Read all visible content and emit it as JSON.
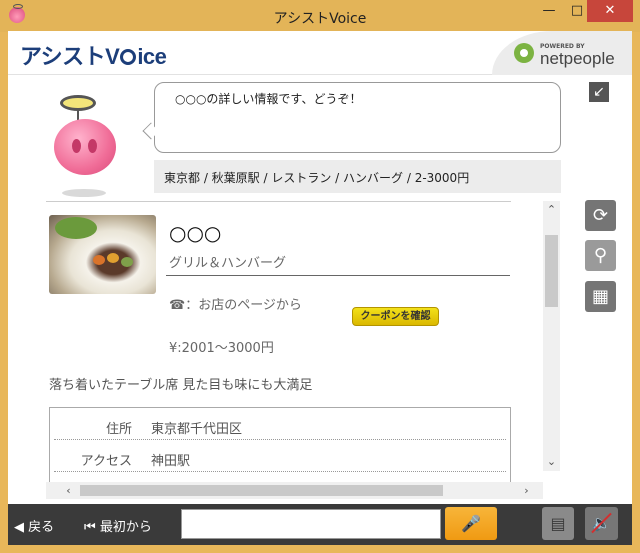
{
  "window": {
    "title": "アシストVoice",
    "min_glyph": "—",
    "max_glyph": "□",
    "close_glyph": "✕"
  },
  "header": {
    "brand_prefix": "アシスト",
    "brand_v": "V",
    "brand_suffix": "ice",
    "powered_by": "POWERED BY",
    "partner": "netpeople"
  },
  "assistant": {
    "message": "○○○の詳しい情報です、どうぞ！",
    "breadcrumb": "東京都 / 秋葉原駅 / レストラン / ハンバーグ / 2-3000円",
    "collapse_glyph": "↙"
  },
  "restaurant": {
    "name": "○○○",
    "genre": "グリル＆ハンバーグ",
    "phone": "☎：お店のページから",
    "coupon_label": "クーポンを確認",
    "price": "¥:2001～3000円",
    "catchphrase": "落ち着いたテーブル席 見た目も味にも大満足",
    "details": [
      {
        "key": "住所",
        "value": "東京都千代田区"
      },
      {
        "key": "アクセス",
        "value": "神田駅"
      }
    ]
  },
  "scroll": {
    "up": "⌃",
    "down": "⌄",
    "left": "‹",
    "right": "›"
  },
  "tools": {
    "refresh_glyph": "⟳",
    "search_glyph": "⚲",
    "map_glyph": "▦"
  },
  "bottom": {
    "back_label": "◀ 戻る",
    "first_label": "⏮ 最初から",
    "input_value": "",
    "mic_glyph": "🎤",
    "log_glyph": "▤",
    "mute_glyph": "🔈"
  }
}
